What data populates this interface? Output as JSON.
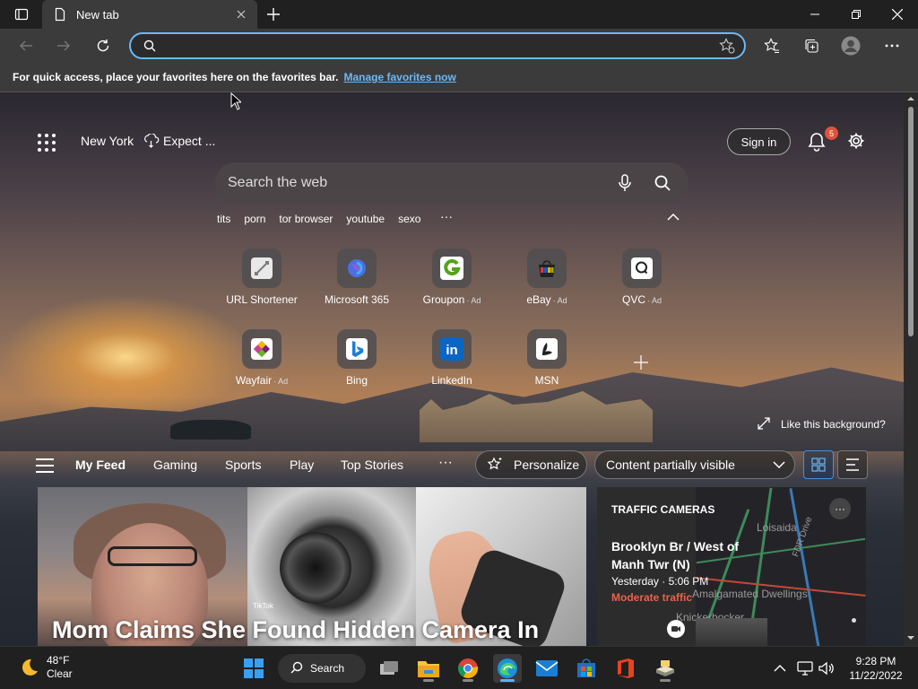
{
  "browser": {
    "tab": {
      "title": "New tab",
      "icon": "page-icon"
    },
    "address": {
      "value": "",
      "placeholder": ""
    },
    "favorites_bar": {
      "message": "For quick access, place your favorites here on the favorites bar.",
      "link": "Manage favorites now"
    },
    "accent_color": "#6cb8f6"
  },
  "newtab": {
    "weather": {
      "location": "New York",
      "condition": "Expect ..."
    },
    "signin_label": "Sign in",
    "notifications_count": "5",
    "search": {
      "placeholder": "Search the web"
    },
    "trending": [
      "tits",
      "porn",
      "tor browser",
      "youtube",
      "sexo"
    ],
    "trending_more": "···",
    "quick_links_row1": [
      {
        "label": "URL Shortener",
        "ad": "",
        "icon": "url-shortener-icon"
      },
      {
        "label": "Microsoft 365",
        "ad": "",
        "icon": "microsoft365-icon"
      },
      {
        "label": "Groupon",
        "ad": "· Ad",
        "icon": "groupon-icon"
      },
      {
        "label": "eBay",
        "ad": "· Ad",
        "icon": "ebay-icon"
      },
      {
        "label": "QVC",
        "ad": "· Ad",
        "icon": "qvc-icon"
      }
    ],
    "quick_links_row2": [
      {
        "label": "Wayfair",
        "ad": "· Ad",
        "icon": "wayfair-icon"
      },
      {
        "label": "Bing",
        "ad": "",
        "icon": "bing-icon"
      },
      {
        "label": "LinkedIn",
        "ad": "",
        "icon": "linkedin-icon"
      },
      {
        "label": "MSN",
        "ad": "",
        "icon": "msn-icon"
      }
    ],
    "like_background": "Like this background?",
    "feed_tabs": [
      "My Feed",
      "Gaming",
      "Sports",
      "Play",
      "Top Stories"
    ],
    "feed_more": "···",
    "personalize_label": "Personalize",
    "content_visibility": "Content partially visible",
    "hero": {
      "title": "Mom Claims She Found Hidden Camera In",
      "watermark": "TikTok"
    },
    "traffic": {
      "header": "TRAFFIC CAMERAS",
      "location": "Brooklyn Br / West of Manh Twr (N)",
      "time": "Yesterday · 5:06 PM",
      "status": "Moderate traffic",
      "status_color": "#e8624a",
      "map_labels": [
        "Loisaida",
        "Amalgamated Dwellings",
        "Knickerbocker",
        "FDR Drive"
      ]
    }
  },
  "taskbar": {
    "weather": {
      "temp": "48°F",
      "condition": "Clear"
    },
    "search_label": "Search",
    "apps": [
      "task-view-icon",
      "file-explorer-icon",
      "chrome-icon",
      "edge-icon",
      "mail-icon",
      "store-icon",
      "office-icon",
      "app-icon"
    ],
    "clock": {
      "time": "9:28 PM",
      "date": "11/22/2022"
    }
  }
}
